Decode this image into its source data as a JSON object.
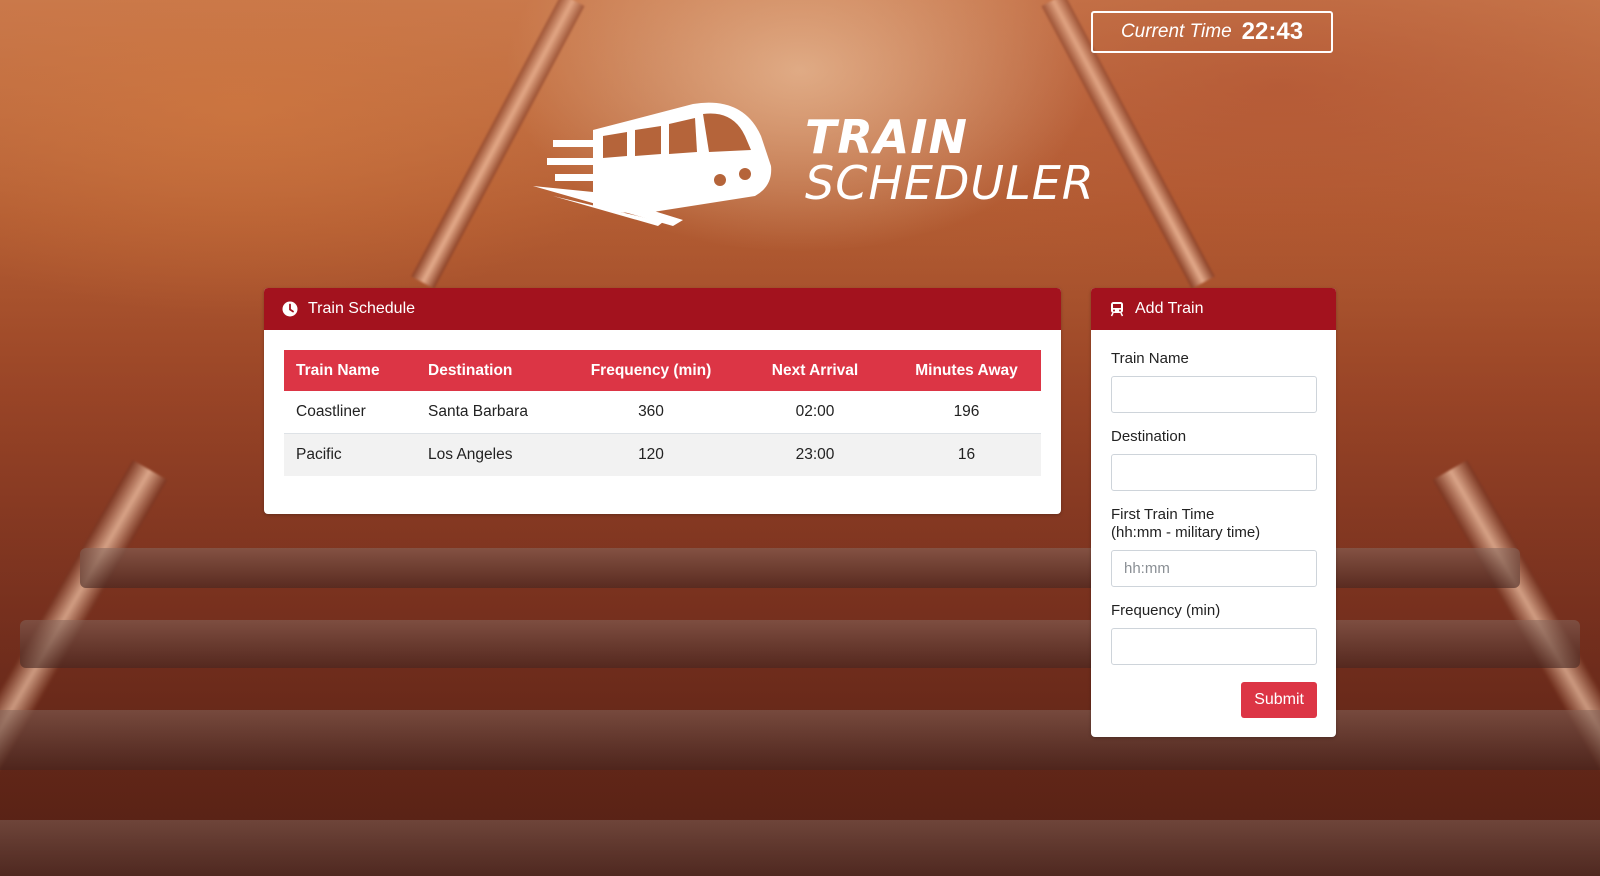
{
  "app": {
    "title_line1": "TRAIN",
    "title_line2": "SCHEDULER"
  },
  "clock": {
    "label": "Current Time",
    "value": "22:43"
  },
  "schedule": {
    "header_icon": "clock-icon",
    "title": "Train Schedule",
    "columns": [
      "Train Name",
      "Destination",
      "Frequency (min)",
      "Next Arrival",
      "Minutes Away"
    ],
    "rows": [
      [
        "Coastliner",
        "Santa Barbara",
        "360",
        "02:00",
        "196"
      ],
      [
        "Pacific",
        "Los Angeles",
        "120",
        "23:00",
        "16"
      ]
    ]
  },
  "add_train": {
    "header_icon": "train-icon",
    "title": "Add Train",
    "fields": {
      "train_name": {
        "label": "Train Name",
        "value": "",
        "placeholder": ""
      },
      "destination": {
        "label": "Destination",
        "value": "",
        "placeholder": ""
      },
      "first_train_time": {
        "label_line1": "First Train Time",
        "label_line2": "(hh:mm - military time)",
        "value": "",
        "placeholder": "hh:mm"
      },
      "frequency": {
        "label": "Frequency (min)",
        "value": "",
        "placeholder": ""
      }
    },
    "submit_label": "Submit"
  },
  "colors": {
    "panel_header": "#a3121e",
    "table_header": "#dc3545",
    "submit_button": "#dc3545"
  }
}
